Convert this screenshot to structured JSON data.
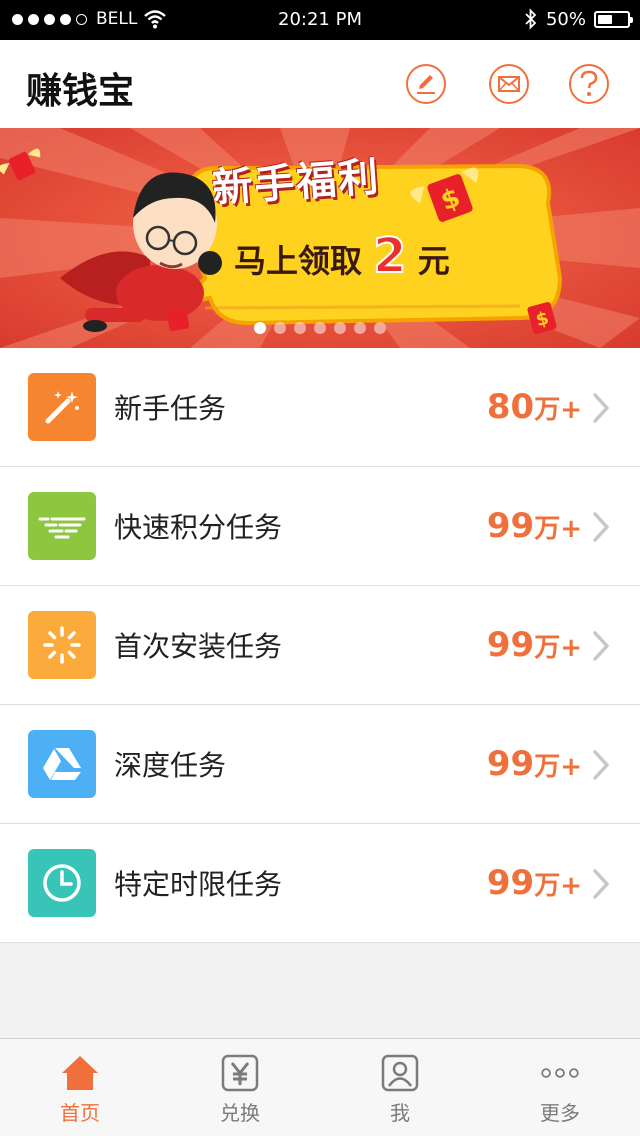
{
  "status_bar": {
    "carrier": "BELL",
    "time": "20:21  PM",
    "battery_percent": "50%",
    "battery_level": 0.5
  },
  "header": {
    "title": "赚钱宝"
  },
  "banner": {
    "headline": "新手福利",
    "subline_prefix": "马上领取",
    "subline_amount": "2",
    "subline_suffix": "元",
    "page_count": 7,
    "active_page": 0
  },
  "tasks": [
    {
      "label": "新手任务",
      "count": "80",
      "unit": "万+",
      "icon": "magic-wand-icon",
      "color": "#f5862f"
    },
    {
      "label": "快速积分任务",
      "count": "99",
      "unit": "万+",
      "icon": "speed-lines-icon",
      "color": "#8dc63f"
    },
    {
      "label": "首次安装任务",
      "count": "99",
      "unit": "万+",
      "icon": "loading-spinner-icon",
      "color": "#fbaa3c"
    },
    {
      "label": "深度任务",
      "count": "99",
      "unit": "万+",
      "icon": "drive-triangle-icon",
      "color": "#4db0f5"
    },
    {
      "label": "特定时限任务",
      "count": "99",
      "unit": "万+",
      "icon": "clock-icon",
      "color": "#38c5b8"
    }
  ],
  "tabbar": {
    "items": [
      {
        "label": "首页",
        "icon": "home-icon",
        "active": true
      },
      {
        "label": "兑换",
        "icon": "yen-icon",
        "active": false
      },
      {
        "label": "我",
        "icon": "user-icon",
        "active": false
      },
      {
        "label": "更多",
        "icon": "more-icon",
        "active": false
      }
    ]
  },
  "colors": {
    "accent": "#f0703c",
    "banner_red": "#e84a3a",
    "banner_yellow": "#ffd21f"
  }
}
